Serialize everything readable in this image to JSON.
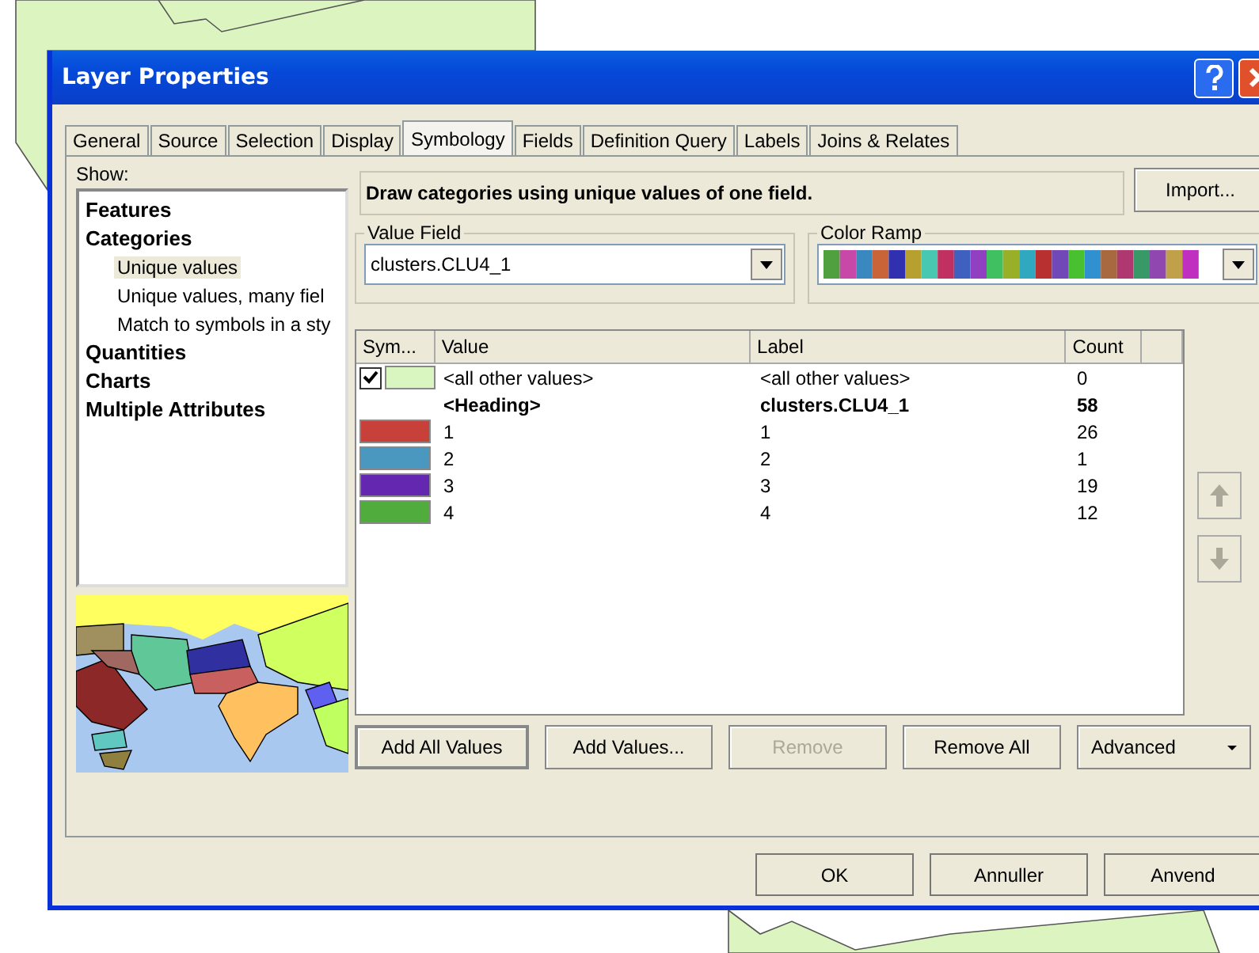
{
  "window": {
    "title": "Layer Properties"
  },
  "tabs": [
    {
      "label": "General",
      "selected": false
    },
    {
      "label": "Source",
      "selected": false
    },
    {
      "label": "Selection",
      "selected": false
    },
    {
      "label": "Display",
      "selected": false
    },
    {
      "label": "Symbology",
      "selected": true
    },
    {
      "label": "Fields",
      "selected": false
    },
    {
      "label": "Definition Query",
      "selected": false
    },
    {
      "label": "Labels",
      "selected": false
    },
    {
      "label": "Joins & Relates",
      "selected": false
    }
  ],
  "show": {
    "label": "Show:",
    "tree": [
      {
        "label": "Features",
        "selected": false
      },
      {
        "label": "Categories",
        "selected": false,
        "children": [
          {
            "label": "Unique values",
            "selected": true
          },
          {
            "label": "Unique values, many fiel",
            "selected": false
          },
          {
            "label": "Match to symbols in a sty",
            "selected": false
          }
        ]
      },
      {
        "label": "Quantities",
        "selected": false
      },
      {
        "label": "Charts",
        "selected": false
      },
      {
        "label": "Multiple Attributes",
        "selected": false
      }
    ]
  },
  "description": "Draw categories using unique values of one field.",
  "import_button": "Import...",
  "value_field": {
    "label": "Value Field",
    "value": "clusters.CLU4_1"
  },
  "color_ramp": {
    "label": "Color Ramp"
  },
  "table": {
    "columns": [
      "Sym...",
      "Value",
      "Label",
      "Count"
    ],
    "rows": [
      {
        "kind": "other",
        "checked": true,
        "color": "#d9f5c0",
        "value": "<all other values>",
        "label": "<all other values>",
        "count": "0"
      },
      {
        "kind": "heading",
        "value": "<Heading>",
        "label": "clusters.CLU4_1",
        "count": "58"
      },
      {
        "kind": "class",
        "color": "#c8403a",
        "value": "1",
        "label": "1",
        "count": "26"
      },
      {
        "kind": "class",
        "color": "#4a98c0",
        "value": "2",
        "label": "2",
        "count": "1"
      },
      {
        "kind": "class",
        "color": "#6428b0",
        "value": "3",
        "label": "3",
        "count": "19"
      },
      {
        "kind": "class",
        "color": "#50ac3c",
        "value": "4",
        "label": "4",
        "count": "12"
      }
    ]
  },
  "action_buttons": [
    {
      "label": "Add All Values",
      "disabled": false,
      "default": true
    },
    {
      "label": "Add Values...",
      "disabled": false,
      "default": false
    },
    {
      "label": "Remove",
      "disabled": true,
      "default": false
    },
    {
      "label": "Remove All",
      "disabled": false,
      "default": false
    }
  ],
  "advanced_button": "Advanced",
  "dialog_buttons": [
    "OK",
    "Annuller",
    "Anvend"
  ]
}
